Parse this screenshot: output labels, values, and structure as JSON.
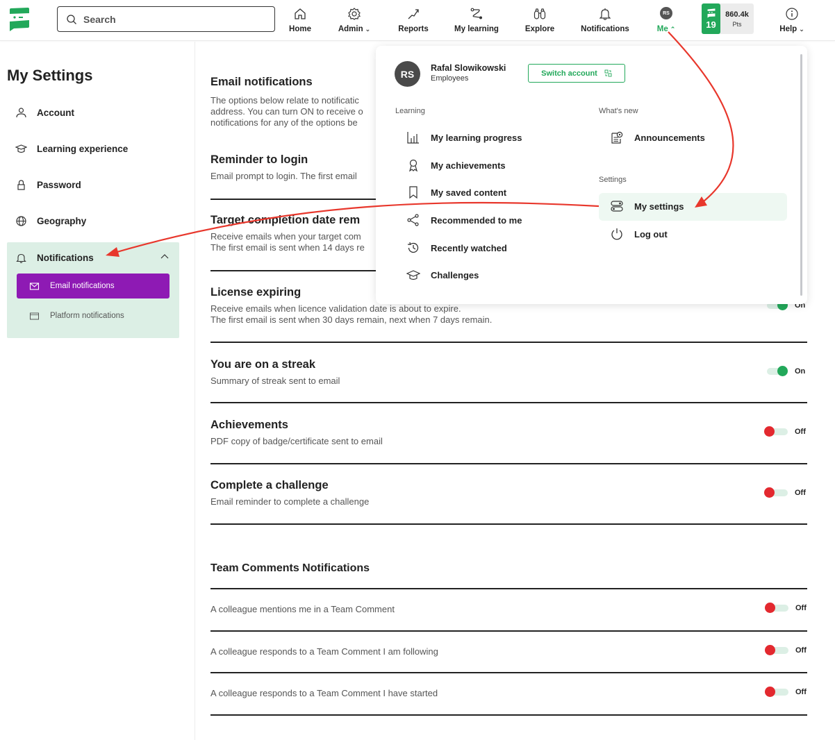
{
  "header": {
    "search_placeholder": "Search",
    "nav": [
      {
        "label": "Home",
        "icon": "home-icon"
      },
      {
        "label": "Admin",
        "icon": "gear-icon",
        "dropdown": true
      },
      {
        "label": "Reports",
        "icon": "trend-icon"
      },
      {
        "label": "My learning",
        "icon": "path-icon"
      },
      {
        "label": "Explore",
        "icon": "binoculars-icon"
      },
      {
        "label": "Notifications",
        "icon": "bell-icon"
      },
      {
        "label": "Me",
        "icon": "avatar",
        "dropdown": true,
        "active": true,
        "initials": "RS"
      },
      {
        "label": "Help",
        "icon": "info-icon",
        "dropdown": true
      }
    ],
    "points": {
      "level": "19",
      "value": "860.4k",
      "unit": "Pts"
    }
  },
  "sidebar": {
    "title": "My Settings",
    "items": [
      {
        "label": "Account",
        "icon": "user-icon"
      },
      {
        "label": "Learning experience",
        "icon": "graduation-cap-icon"
      },
      {
        "label": "Password",
        "icon": "lock-icon"
      },
      {
        "label": "Geography",
        "icon": "globe-icon"
      },
      {
        "label": "Notifications",
        "icon": "bell-icon",
        "expanded": true
      }
    ],
    "notifications_sub": [
      {
        "label": "Email notifications",
        "icon": "mail-icon",
        "active": true
      },
      {
        "label": "Platform notifications",
        "icon": "window-icon"
      }
    ]
  },
  "main": {
    "intro": {
      "title": "Email notifications",
      "lines": [
        "The options below relate to notificatic",
        "address. You can turn ON to receive o",
        "notifications for any of the options be"
      ]
    },
    "sections": [
      {
        "title": "Reminder to login",
        "desc": [
          "Email prompt to login. The first email"
        ]
      },
      {
        "title": "Target completion date rem",
        "desc": [
          "Receive emails when your target com",
          "The first email is sent when 14 days re"
        ]
      },
      {
        "title": "License expiring",
        "desc": [
          "Receive emails when licence validation date is about to expire.",
          "The first email is sent when 30 days remain, next when 7 days remain."
        ],
        "state": "On",
        "on": true
      },
      {
        "title": "You are on a streak",
        "desc": [
          "Summary of streak sent to email"
        ],
        "state": "On",
        "on": true
      },
      {
        "title": "Achievements",
        "desc": [
          "PDF copy of badge/certificate sent to email"
        ],
        "state": "Off",
        "on": false
      },
      {
        "title": "Complete a challenge",
        "desc": [
          "Email reminder to complete a challenge"
        ],
        "state": "Off",
        "on": false
      }
    ],
    "team": {
      "title": "Team Comments Notifications",
      "items": [
        {
          "label": "A colleague mentions me in a Team Comment",
          "state": "Off",
          "on": false
        },
        {
          "label": "A colleague responds to a Team Comment I am following",
          "state": "Off",
          "on": false
        },
        {
          "label": "A colleague responds to a Team Comment I have started",
          "state": "Off",
          "on": false
        }
      ]
    }
  },
  "me_menu": {
    "user": {
      "initials": "RS",
      "name": "Rafal Slowikowski",
      "org": "Employees"
    },
    "switch_account": "Switch account",
    "learning_heading": "Learning",
    "learning_items": [
      {
        "label": "My learning progress",
        "icon": "bar-chart-icon"
      },
      {
        "label": "My achievements",
        "icon": "ribbon-icon"
      },
      {
        "label": "My saved content",
        "icon": "bookmark-icon"
      },
      {
        "label": "Recommended to me",
        "icon": "share-icon"
      },
      {
        "label": "Recently watched",
        "icon": "history-icon"
      },
      {
        "label": "Challenges",
        "icon": "graduation-cap-icon"
      }
    ],
    "whats_new_heading": "What's new",
    "whats_new_items": [
      {
        "label": "Announcements",
        "icon": "announcement-icon"
      }
    ],
    "settings_heading": "Settings",
    "settings_items": [
      {
        "label": "My settings",
        "icon": "toggles-icon",
        "highlighted": true
      },
      {
        "label": "Log out",
        "icon": "power-icon"
      }
    ]
  },
  "colors": {
    "brand_green": "#22a85a",
    "active_purple": "#8e1ab4",
    "toggle_off_red": "#e3292f",
    "sidebar_group_bg": "#dcefe5",
    "annotation_arrow": "#e8372c"
  }
}
